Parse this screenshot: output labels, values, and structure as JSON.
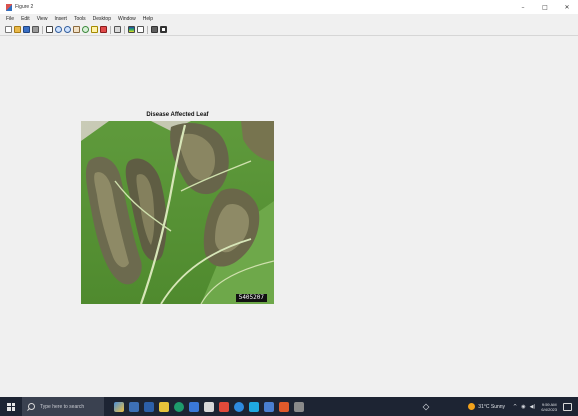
{
  "window": {
    "title": "Figure 2",
    "minimize_glyph": "–",
    "maximize_glyph": "□",
    "close_glyph": "✕"
  },
  "menubar": {
    "items": [
      {
        "label": "File"
      },
      {
        "label": "Edit"
      },
      {
        "label": "View"
      },
      {
        "label": "Insert"
      },
      {
        "label": "Tools"
      },
      {
        "label": "Desktop"
      },
      {
        "label": "Window"
      },
      {
        "label": "Help"
      }
    ]
  },
  "toolbar": {
    "tools": [
      "new-figure-icon",
      "open-file-icon",
      "save-icon",
      "print-icon",
      "edit-plot-arrow-icon",
      "zoom-in-icon",
      "zoom-out-icon",
      "pan-icon",
      "rotate-3d-icon",
      "data-cursor-icon",
      "brush-icon",
      "link-plot-icon",
      "insert-colorbar-icon",
      "insert-legend-icon",
      "hide-plot-tools-icon",
      "show-plot-tools-icon"
    ]
  },
  "figure": {
    "axes_title": "Disease Affected Leaf",
    "image_id_label": "5405207",
    "image_subject": "leaf-photo"
  },
  "taskbar": {
    "search_placeholder": "Type here to search",
    "weather": "31°C Sunny",
    "clock_time": "9:59 AM",
    "clock_date": "6/4/2023",
    "pinned_apps": [
      "task-view-icon",
      "file-explorer-icon",
      "store-icon",
      "chrome-icon",
      "edge-icon",
      "office-icon",
      "files-icon",
      "matlab-icon",
      "mail-icon",
      "media-player-icon",
      "app-icon",
      "feather-icon"
    ]
  }
}
